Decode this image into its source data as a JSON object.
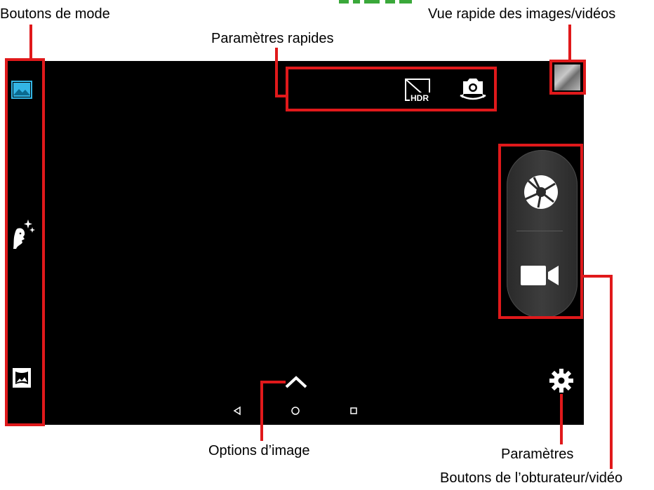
{
  "annotations": {
    "mode_buttons": "Boutons de mode",
    "quick_view": "Vue rapide des images/vidéos",
    "quick_settings": "Paramètres rapides",
    "image_options": "Options d’image",
    "settings": "Paramètres",
    "shutter_video": "Boutons de l’obturateur/vidéo"
  },
  "colors": {
    "annotation_red": "#e0191b",
    "screen_background": "#000000",
    "photo_mode_accent": "#33b5e5",
    "icon_white": "#ffffff"
  },
  "quick_settings": {
    "hdr_badge": "HDR"
  },
  "mode_icons": [
    "photo-mode-icon",
    "beauty-mode-icon",
    "panorama-mode-icon"
  ],
  "camera_icons": [
    "hdr-off-icon",
    "switch-camera-icon",
    "shutter-icon",
    "video-camera-icon",
    "settings-gear-icon",
    "chevron-up-icon"
  ],
  "nav_icons": [
    "back-icon",
    "home-icon",
    "recents-icon"
  ]
}
